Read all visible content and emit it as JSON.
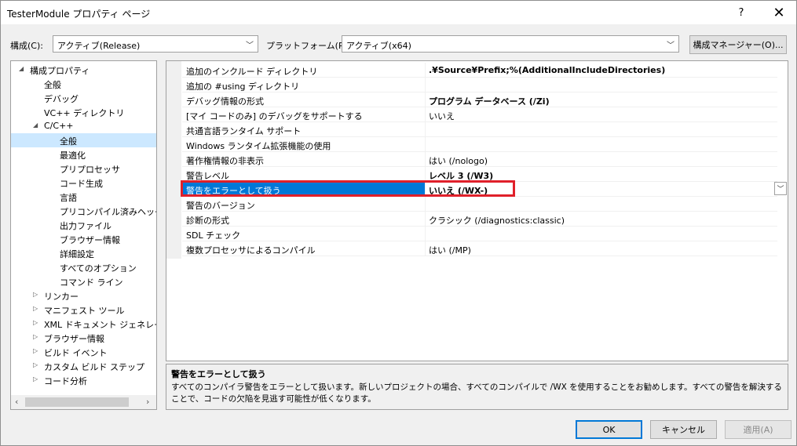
{
  "window": {
    "title": "TesterModule プロパティ ページ",
    "help": "?",
    "close": "✕"
  },
  "config": {
    "config_label": "構成(C):",
    "config_value": "アクティブ(Release)",
    "platform_label": "プラットフォーム(P):",
    "platform_value": "アクティブ(x64)",
    "manager_button": "構成マネージャー(O)..."
  },
  "tree": {
    "items": [
      {
        "label": "構成プロパティ",
        "expander": "◢"
      },
      {
        "label": "全般"
      },
      {
        "label": "デバッグ"
      },
      {
        "label": "VC++ ディレクトリ"
      },
      {
        "label": "C/C++",
        "expander": "◢"
      },
      {
        "label": "全般",
        "selected": true
      },
      {
        "label": "最適化"
      },
      {
        "label": "プリプロセッサ"
      },
      {
        "label": "コード生成"
      },
      {
        "label": "言語"
      },
      {
        "label": "プリコンパイル済みヘッダー"
      },
      {
        "label": "出力ファイル"
      },
      {
        "label": "ブラウザー情報"
      },
      {
        "label": "詳細設定"
      },
      {
        "label": "すべてのオプション"
      },
      {
        "label": "コマンド ライン"
      },
      {
        "label": "リンカー",
        "expander": "▷"
      },
      {
        "label": "マニフェスト ツール",
        "expander": "▷"
      },
      {
        "label": "XML ドキュメント ジェネレーター",
        "expander": "▷"
      },
      {
        "label": "ブラウザー情報",
        "expander": "▷"
      },
      {
        "label": "ビルド イベント",
        "expander": "▷"
      },
      {
        "label": "カスタム ビルド ステップ",
        "expander": "▷"
      },
      {
        "label": "コード分析",
        "expander": "▷"
      }
    ]
  },
  "grid": {
    "rows": [
      {
        "name": "追加のインクルード ディレクトリ",
        "value": ".¥Source¥Prefix;%(AdditionalIncludeDirectories)",
        "bold": true
      },
      {
        "name": "追加の #using ディレクトリ",
        "value": ""
      },
      {
        "name": "デバッグ情報の形式",
        "value": "プログラム データベース (/Zi)",
        "bold": true
      },
      {
        "name": "[マイ コードのみ] のデバッグをサポートする",
        "value": "いいえ"
      },
      {
        "name": "共通言語ランタイム サポート",
        "value": ""
      },
      {
        "name": "Windows ランタイム拡張機能の使用",
        "value": ""
      },
      {
        "name": "著作権情報の非表示",
        "value": "はい (/nologo)"
      },
      {
        "name": "警告レベル",
        "value": "レベル 3 (/W3)",
        "bold": true
      },
      {
        "name": "警告をエラーとして扱う",
        "value": "いいえ (/WX-)",
        "selected": true
      },
      {
        "name": "警告のバージョン",
        "value": ""
      },
      {
        "name": "診断の形式",
        "value": "クラシック (/diagnostics:classic)"
      },
      {
        "name": "SDL チェック",
        "value": ""
      },
      {
        "name": "複数プロセッサによるコンパイル",
        "value": "はい (/MP)"
      }
    ]
  },
  "description": {
    "title": "警告をエラーとして扱う",
    "text": "すべてのコンパイラ警告をエラーとして扱います。新しいプロジェクトの場合、すべてのコンパイルで /WX を使用することをお勧めします。すべての警告を解決することで、コードの欠陥を見逃す可能性が低くなります。"
  },
  "buttons": {
    "ok": "OK",
    "cancel": "キャンセル",
    "apply": "適用(A)"
  },
  "colors": {
    "selection": "#0078d7",
    "highlight_box": "#e0202a",
    "tree_selected": "#cce8ff"
  }
}
